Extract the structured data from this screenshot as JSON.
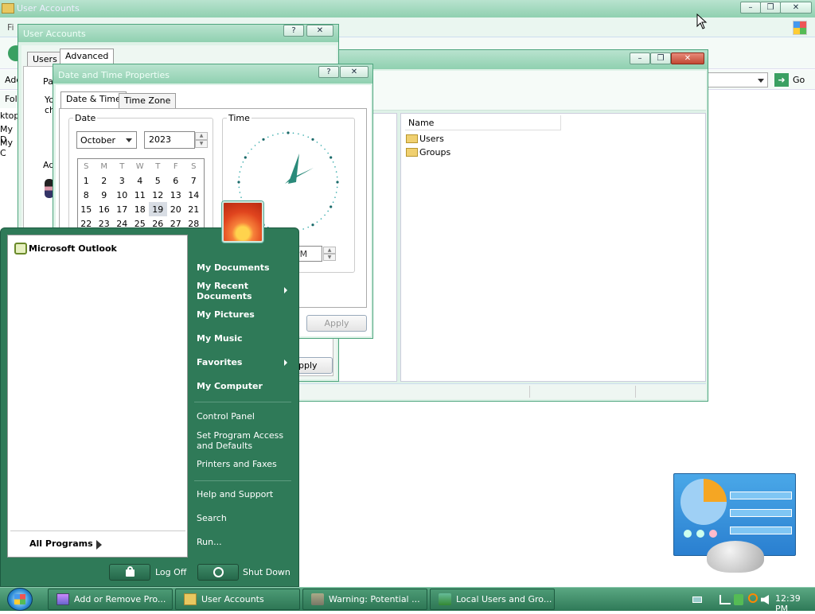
{
  "bg_window": {
    "title": "User Accounts",
    "menu_partial": "Fi",
    "address_partial": "Add",
    "folders_partial": "Fol",
    "tree_partial": [
      "ktop",
      "My D",
      "My C"
    ],
    "go_label": "Go"
  },
  "mmc_window": {
    "list_header": "Name",
    "items": [
      "Users",
      "Groups"
    ]
  },
  "user_accounts_dialog": {
    "title": "User Accounts",
    "tabs": [
      "Users",
      "Advanced"
    ],
    "frag_pa": "Pa",
    "frag_yo": "Yo",
    "frag_ch": "ch",
    "frag_ad": "Ad",
    "apply_partial": "pply"
  },
  "datetime_dialog": {
    "title": "Date and Time Properties",
    "tabs": [
      "Date & Time",
      "Time Zone"
    ],
    "date_group": "Date",
    "time_group": "Time",
    "month": "October",
    "year": "2023",
    "weekdays": [
      "S",
      "M",
      "T",
      "W",
      "T",
      "F",
      "S"
    ],
    "weeks": [
      [
        "1",
        "2",
        "3",
        "4",
        "5",
        "6",
        "7"
      ],
      [
        "8",
        "9",
        "10",
        "11",
        "12",
        "13",
        "14"
      ],
      [
        "15",
        "16",
        "17",
        "18",
        "19",
        "20",
        "21"
      ],
      [
        "22",
        "23",
        "24",
        "25",
        "26",
        "27",
        "28"
      ]
    ],
    "selected_day": "19",
    "time_partial": "PM",
    "apply_label": "Apply"
  },
  "start_menu": {
    "pinned": [
      {
        "label": "Microsoft Outlook",
        "icon": "outlook-icon"
      }
    ],
    "all_programs": "All Programs",
    "right_items": [
      "My Documents",
      "My Recent Documents",
      "My Pictures",
      "My Music",
      "Favorites",
      "My Computer",
      "Control Panel",
      "Set Program Access and Defaults",
      "Printers and Faxes",
      "Help and Support",
      "Search",
      "Run..."
    ],
    "log_off": "Log Off",
    "shut_down": "Shut Down"
  },
  "taskbar": {
    "tasks": [
      {
        "label": "Add or Remove Pro...",
        "icon": "programs-icon"
      },
      {
        "label": "User Accounts",
        "icon": "folder-users-icon"
      },
      {
        "label": "Warning: Potential ...",
        "icon": "warning-icon"
      },
      {
        "label": "Local Users and Gro...",
        "icon": "users-icon"
      }
    ],
    "clock": "12:39 PM"
  },
  "colors": {
    "accent": "#2f7a58",
    "start_menu_right": "#2d7556",
    "taskbar": "#3a8a64"
  }
}
